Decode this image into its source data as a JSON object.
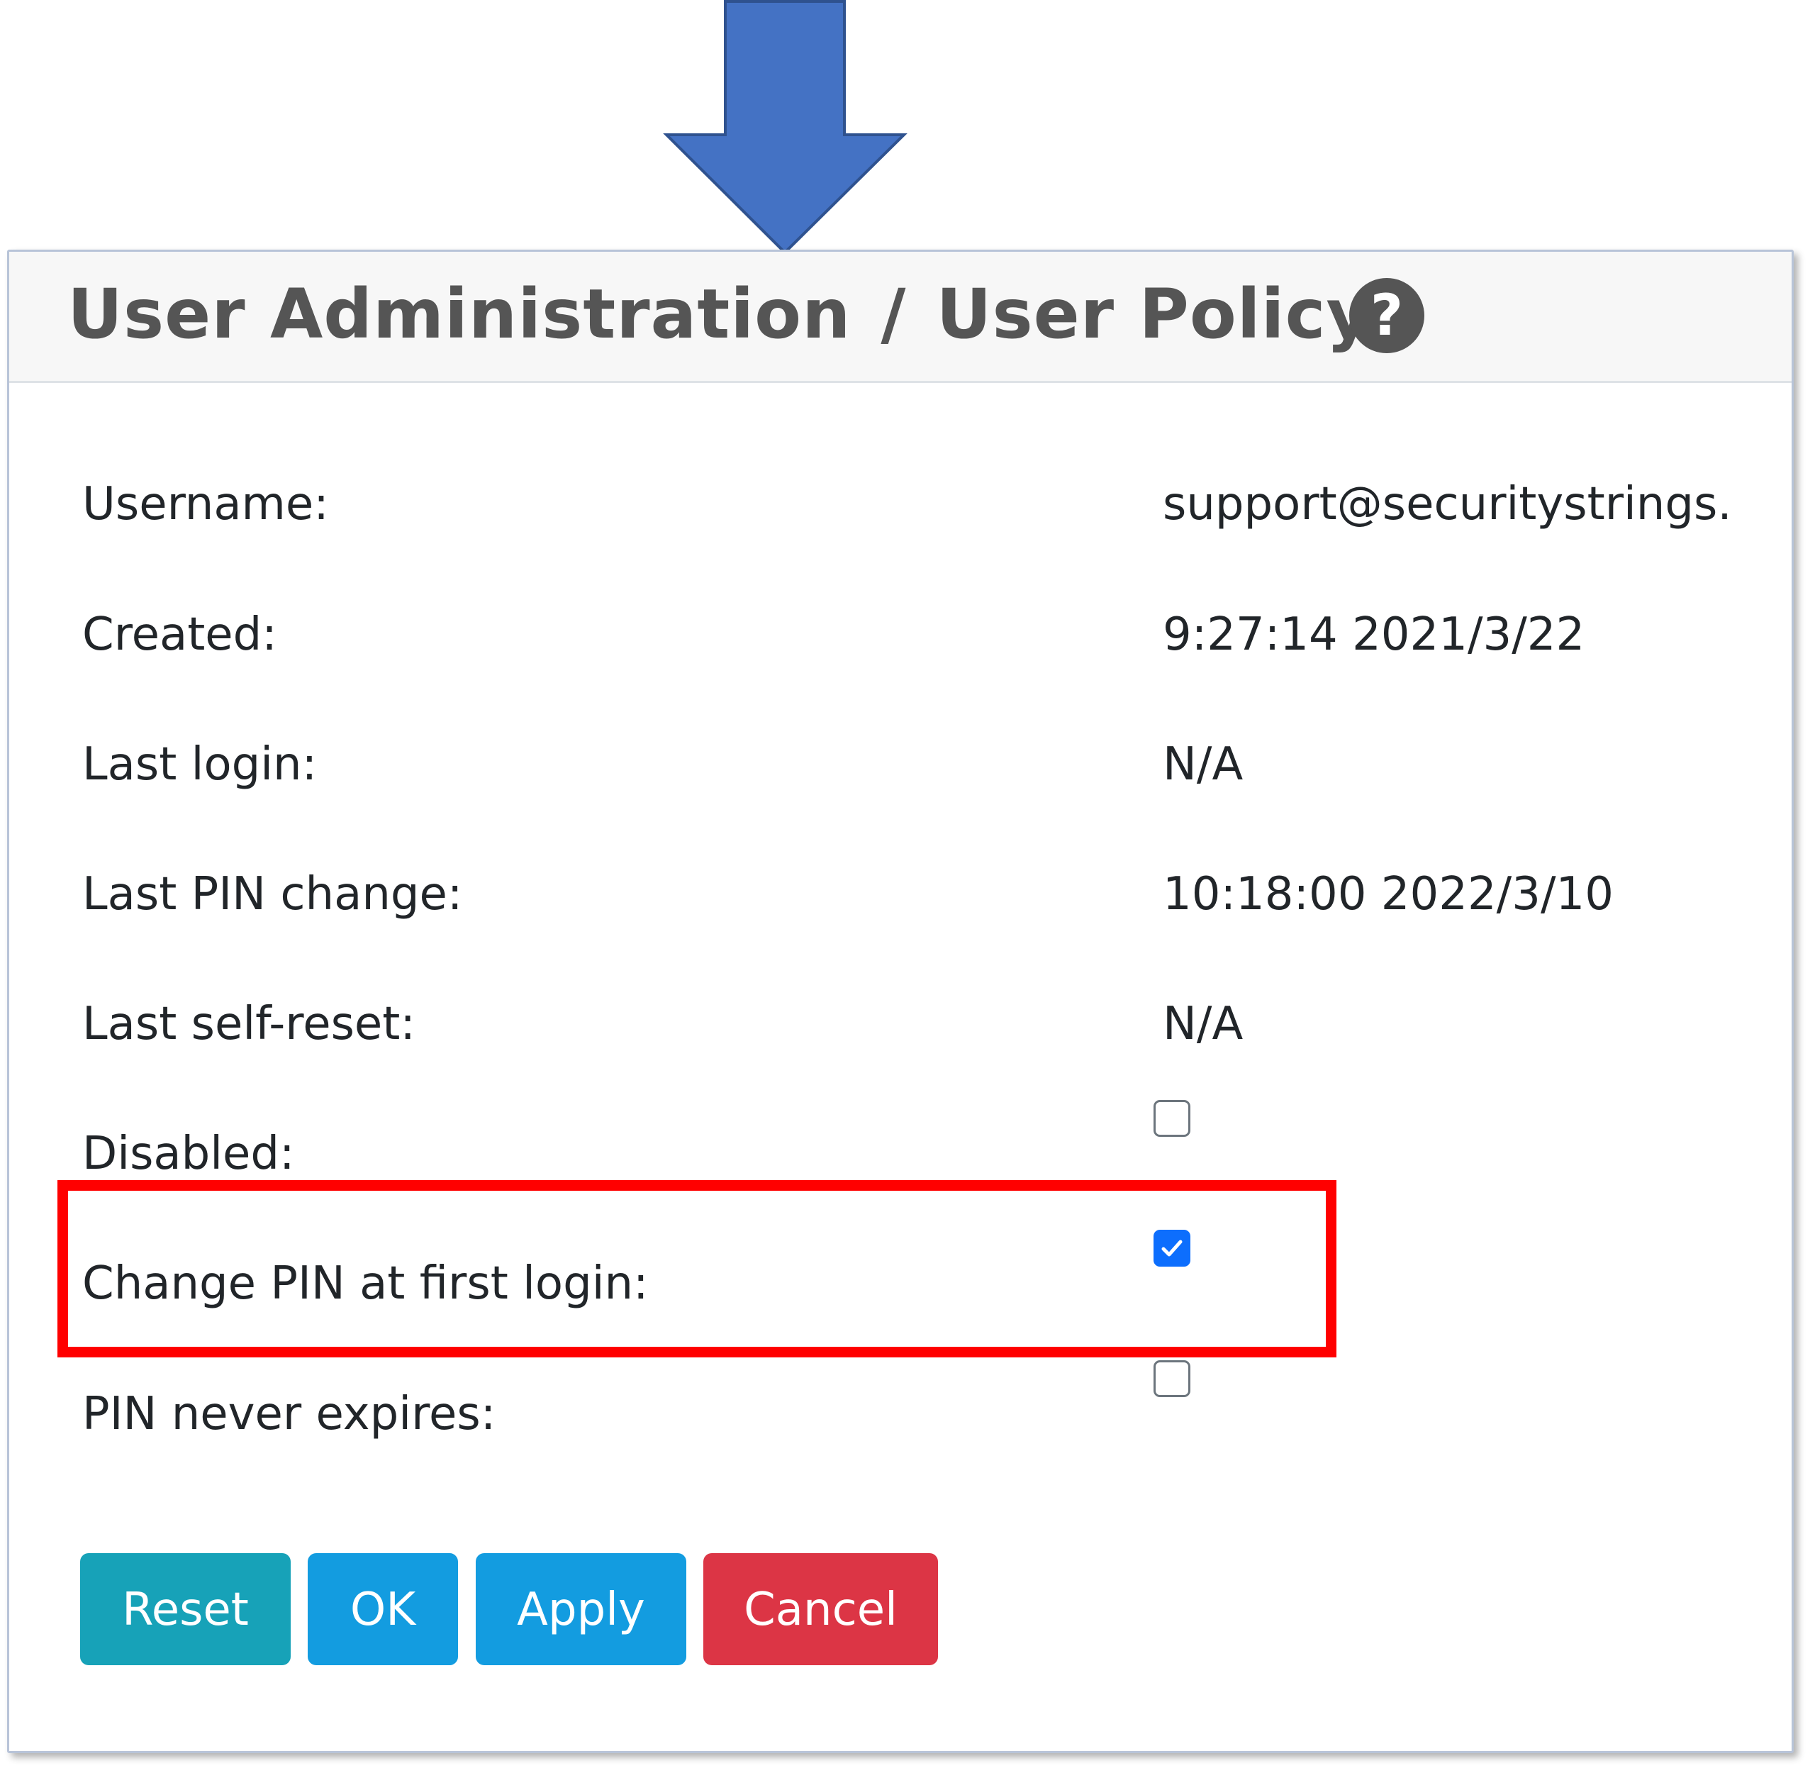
{
  "colors": {
    "arrow_fill": "#4472c4",
    "highlight": "#ff0000",
    "reset": "#17a2b8",
    "primary": "#139ce0",
    "cancel": "#dc3545",
    "checkbox_checked": "#0d6efd"
  },
  "header": {
    "breadcrumb_parent": "User Administration",
    "separator": "/",
    "title": "User Policy",
    "help_icon": "question-circle-icon",
    "help_glyph": "?"
  },
  "fields": {
    "username": {
      "label": "Username:",
      "value": "support@securitystrings."
    },
    "created": {
      "label": "Created:",
      "value": "9:27:14 2021/3/22"
    },
    "last_login": {
      "label": "Last login:",
      "value": "N/A"
    },
    "last_pin_change": {
      "label": "Last PIN change:",
      "value": "10:18:00 2022/3/10"
    },
    "last_self_reset": {
      "label": "Last self-reset:",
      "value": "N/A"
    },
    "disabled": {
      "label": "Disabled:",
      "checked": false
    },
    "change_pin_first_login": {
      "label": "Change PIN at first login:",
      "checked": true
    },
    "pin_never_expires": {
      "label": "PIN never expires:",
      "checked": false
    }
  },
  "buttons": {
    "reset": "Reset",
    "ok": "OK",
    "apply": "Apply",
    "cancel": "Cancel"
  }
}
